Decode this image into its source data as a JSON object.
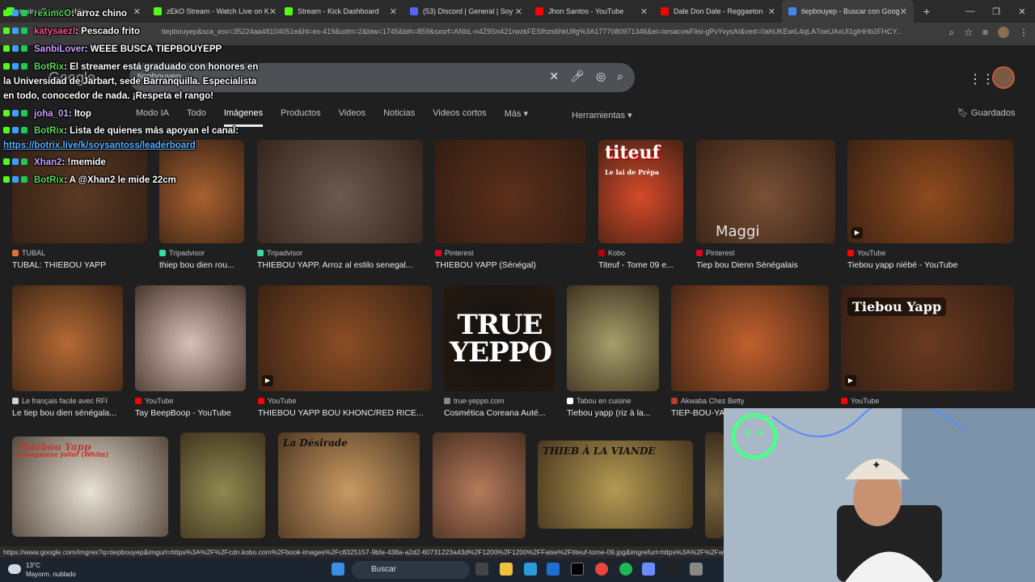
{
  "browser": {
    "tabs": [
      {
        "label": "reximcO : arroz chino",
        "color": "#53fc18"
      },
      {
        "label": "zEkO Stream - Watch Live on K",
        "color": "#53fc18"
      },
      {
        "label": "Stream - Kick Dashboard",
        "color": "#53fc18"
      },
      {
        "label": "(53) Discord | General | Soy",
        "color": "#5865f2"
      },
      {
        "label": "Jhon Santos - YouTube",
        "color": "#ff0000"
      },
      {
        "label": "Dale Don Dale - Reggaeton",
        "color": "#ff0000"
      },
      {
        "label": "tiepbouyep - Buscar con Goog",
        "color": "#4285f4"
      }
    ],
    "url": "tiepbouyep&sca_esv=35224aa48104051e&hl=es-419&udm=2&biw=1745&bih=859&sxsrf=ANbL-n4Z9Sn421rwzkFESfhzs6hkUlfg%3A1777080971346&ei=ixrsacvwFlisi-gPvYvysAI&ved=0ahUKEwiL4qLA7oeUAxUI1glHHb2FHCY..."
  },
  "google": {
    "logo": "Google",
    "query": "tiepbouyep",
    "nav": [
      "Modo IA",
      "Todo",
      "Imágenes",
      "Productos",
      "Videos",
      "Noticias",
      "Videos cortos",
      "Más"
    ],
    "tools": "Herramientas",
    "saved": "Guardados"
  },
  "results": [
    {
      "source": "TUBAL",
      "title": "TUBAL: THIEBOU YAPP",
      "thumb": "#5a3a24",
      "srcColor": "#e0703a"
    },
    {
      "source": "Tripadvisor",
      "title": "thiep bou dien rou...",
      "thumb": "#a8612f",
      "srcColor": "#34e0a1"
    },
    {
      "source": "Tripadvisor",
      "title": "THIEBOU YAPP. Arroz al estilo senegal...",
      "thumb": "#6b5a52",
      "srcColor": "#34e0a1"
    },
    {
      "source": "Pinterest",
      "title": "THIEBOU YAPP (Sénégal)",
      "thumb": "#5c2f1c",
      "srcColor": "#e60023"
    },
    {
      "source": "Kobo",
      "title": "Titeuf - Tome 09 e...",
      "thumb": "#d64a2a",
      "srcColor": "#bf0000"
    },
    {
      "source": "Pinterest",
      "title": "Tiep bou Dienn Sénégalais",
      "thumb": "#7a5036",
      "srcColor": "#e60023"
    },
    {
      "source": "YouTube",
      "title": "Tiebou yapp niébé - YouTube",
      "thumb": "#8e4a1e",
      "srcColor": "#ff0000"
    },
    {
      "source": "Le français facile avec RFI",
      "title": "Le tiep bou dien sénégala...",
      "thumb": "#b46a34",
      "srcColor": "#d0d0d0"
    },
    {
      "source": "YouTube",
      "title": "Tay BeepBoop - YouTube",
      "thumb": "#d8c0b8",
      "srcColor": "#ff0000"
    },
    {
      "source": "YouTube",
      "title": "THIEBOU YAPP BOU KHONC/RED RICE...",
      "thumb": "#8a4d24",
      "srcColor": "#ff0000"
    },
    {
      "source": "true-yeppo.com",
      "title": "Cosmética Coreana Auté...",
      "thumb": "#111111",
      "srcColor": "#888888"
    },
    {
      "source": "Tabou en cuisine",
      "title": "Tiebou yapp (riz à la...",
      "thumb": "#a4a06a",
      "srcColor": "#ffffff"
    },
    {
      "source": "Akwaba Chez Betty",
      "title": "TIEP-BOU-YA...",
      "thumb": "#c0602e",
      "srcColor": "#c0392b"
    },
    {
      "source": "YouTube",
      "title": "",
      "thumb": "#6a3a20",
      "srcColor": "#ff0000"
    }
  ],
  "row3": [
    {
      "thumb": "#e9e2d6",
      "caption": "Thiébou Yapp"
    },
    {
      "thumb": "#8e8a50",
      "caption": ""
    },
    {
      "thumb": "#c99a62",
      "caption": "La Désirade"
    },
    {
      "thumb": "#b57a5c",
      "caption": ""
    },
    {
      "thumb": "#b39a52",
      "caption": "THIEB À LA VIANDE"
    },
    {
      "thumb": "#7e6a40",
      "caption": ""
    }
  ],
  "thumbText": {
    "titeuf": "titeuf",
    "titeuf_sub": "Le lai de Prépa",
    "maggi": "Maggi",
    "trueyeppo": "TRUE YEPPO",
    "tiebou": "Tiebou Yapp",
    "senegalese": "Senegalese Jollof (White)"
  },
  "chat": [
    {
      "user": "reximcO",
      "text": ": arroz chino",
      "userClass": "user-green"
    },
    {
      "user": "katysaezl",
      "text": ": Pescado frito",
      "userClass": "user-pink"
    },
    {
      "user": "SanbiLover",
      "text": ": WEEE BUSCA TIEPBOUYEPP",
      "userClass": "user-violet"
    },
    {
      "user": "BotRix",
      "text": ": El streamer está graduado con honores en",
      "userClass": "user-green"
    },
    {
      "user": "",
      "text": "la Universidad de Jarbart, sede Barranquilla. Especialista",
      "userClass": ""
    },
    {
      "user": "",
      "text": "en todo, conocedor de nada. ¡Respeta el rango!",
      "userClass": ""
    },
    {
      "user": "joha_01",
      "text": ": ltop",
      "userClass": "user-violet"
    },
    {
      "user": "BotRix",
      "text": ": Lista de quienes más apoyan el canal:",
      "userClass": "user-green"
    },
    {
      "user": "",
      "text": "https://botrix.live/k/soysantoss/leaderboard",
      "userClass": "link"
    },
    {
      "user": "Xhan2",
      "text": ": !memide",
      "userClass": "user-violet"
    },
    {
      "user": "BotRix",
      "text": ": A @Xhan2 le mide 22cm",
      "userClass": "user-green"
    }
  ],
  "status": {
    "url": "https://www.google.com/imgres?q=tiepbouyep&imgurl=https%3A%2F%2Fcdn.kobo.com%2Fbook-images%2Fc8325157-9bfa-438a-a2d2-60731223a43d%2F1200%2F1200%2FFalse%2Ftiteuf-tome-09.jpg&imgrefurl=https%3A%2F%2Fwww.kobo.com%2F..."
  },
  "taskbar": {
    "temp": "13°C",
    "weather": "Mayorm. nublado",
    "search": "Buscar"
  }
}
